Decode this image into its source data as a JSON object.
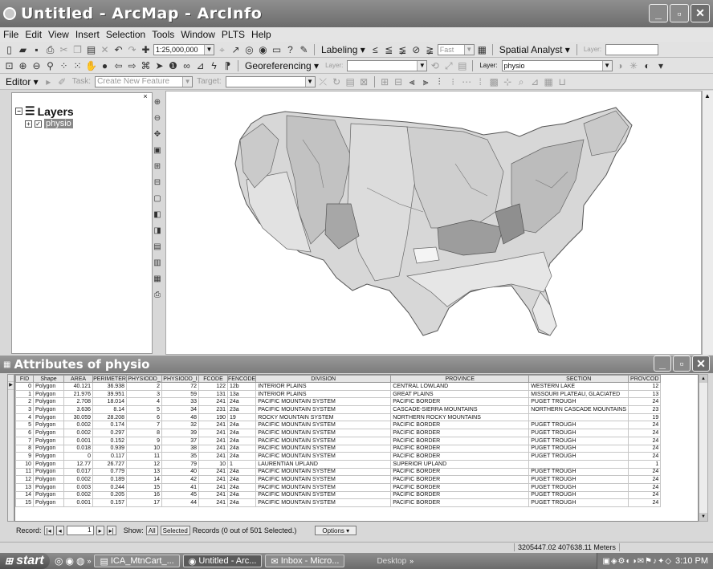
{
  "window": {
    "title": "Untitled - ArcMap - ArcInfo",
    "min": "_",
    "max": "▫",
    "close": "✕"
  },
  "menu": [
    "File",
    "Edit",
    "View",
    "Insert",
    "Selection",
    "Tools",
    "Window",
    "PLTS",
    "Help"
  ],
  "toolbar1": {
    "scale": "1:25,000,000",
    "labeling": "Labeling ▾",
    "fast": "Fast",
    "spatial_analyst": "Spatial Analyst ▾",
    "layer_label": "Layer:"
  },
  "toolbar2": {
    "georef": "Georeferencing ▾",
    "layer_label": "Layer:",
    "layer_label2": "Layer:",
    "layer_value": "physio"
  },
  "toolbar3": {
    "editor": "Editor ▾",
    "task_label": "Task:",
    "task_value": "Create New Feature",
    "target_label": "Target:"
  },
  "toc": {
    "heading": "Layers",
    "layer": "physio"
  },
  "attributes": {
    "title": "Attributes of physio",
    "columns": [
      "FID",
      "Shape",
      "AREA",
      "PERIMETER",
      "PHYSIODD_",
      "PHYSIODD_I",
      "FCODE",
      "FENCODE",
      "DIVISION",
      "PROVINCE",
      "SECTION",
      "PROVCOD"
    ],
    "rows": [
      [
        "0",
        "Polygon",
        "40.121",
        "36.938",
        "2",
        "72",
        "122",
        "12b",
        "INTERIOR PLAINS",
        "CENTRAL LOWLAND",
        "WESTERN LAKE",
        "12"
      ],
      [
        "1",
        "Polygon",
        "21.976",
        "39.951",
        "3",
        "59",
        "131",
        "13a",
        "INTERIOR PLAINS",
        "GREAT PLAINS",
        "MISSOURI PLATEAU, GLACIATED",
        "13"
      ],
      [
        "2",
        "Polygon",
        "2.708",
        "18.014",
        "4",
        "33",
        "241",
        "24a",
        "PACIFIC MOUNTAIN SYSTEM",
        "PACIFIC BORDER",
        "PUGET TROUGH",
        "24"
      ],
      [
        "3",
        "Polygon",
        "3.636",
        "8.14",
        "5",
        "34",
        "231",
        "23a",
        "PACIFIC MOUNTAIN SYSTEM",
        "CASCADE-SIERRA MOUNTAINS",
        "NORTHERN CASCADE MOUNTAINS",
        "23"
      ],
      [
        "4",
        "Polygon",
        "30.059",
        "28.208",
        "6",
        "48",
        "190",
        "19",
        "ROCKY MOUNTAIN SYSTEM",
        "NORTHERN ROCKY MOUNTAINS",
        "",
        "19"
      ],
      [
        "5",
        "Polygon",
        "0.002",
        "0.174",
        "7",
        "32",
        "241",
        "24a",
        "PACIFIC MOUNTAIN SYSTEM",
        "PACIFIC BORDER",
        "PUGET TROUGH",
        "24"
      ],
      [
        "6",
        "Polygon",
        "0.002",
        "0.297",
        "8",
        "39",
        "241",
        "24a",
        "PACIFIC MOUNTAIN SYSTEM",
        "PACIFIC BORDER",
        "PUGET TROUGH",
        "24"
      ],
      [
        "7",
        "Polygon",
        "0.001",
        "0.152",
        "9",
        "37",
        "241",
        "24a",
        "PACIFIC MOUNTAIN SYSTEM",
        "PACIFIC BORDER",
        "PUGET TROUGH",
        "24"
      ],
      [
        "8",
        "Polygon",
        "0.018",
        "0.939",
        "10",
        "38",
        "241",
        "24a",
        "PACIFIC MOUNTAIN SYSTEM",
        "PACIFIC BORDER",
        "PUGET TROUGH",
        "24"
      ],
      [
        "9",
        "Polygon",
        "0",
        "0.117",
        "11",
        "35",
        "241",
        "24a",
        "PACIFIC MOUNTAIN SYSTEM",
        "PACIFIC BORDER",
        "PUGET TROUGH",
        "24"
      ],
      [
        "10",
        "Polygon",
        "12.77",
        "26.727",
        "12",
        "79",
        "10",
        "1",
        "LAURENTIAN UPLAND",
        "SUPERIOR UPLAND",
        "",
        "1"
      ],
      [
        "11",
        "Polygon",
        "0.017",
        "0.779",
        "13",
        "40",
        "241",
        "24a",
        "PACIFIC MOUNTAIN SYSTEM",
        "PACIFIC BORDER",
        "PUGET TROUGH",
        "24"
      ],
      [
        "12",
        "Polygon",
        "0.002",
        "0.189",
        "14",
        "42",
        "241",
        "24a",
        "PACIFIC MOUNTAIN SYSTEM",
        "PACIFIC BORDER",
        "PUGET TROUGH",
        "24"
      ],
      [
        "13",
        "Polygon",
        "0.003",
        "0.244",
        "15",
        "41",
        "241",
        "24a",
        "PACIFIC MOUNTAIN SYSTEM",
        "PACIFIC BORDER",
        "PUGET TROUGH",
        "24"
      ],
      [
        "14",
        "Polygon",
        "0.002",
        "0.205",
        "16",
        "45",
        "241",
        "24a",
        "PACIFIC MOUNTAIN SYSTEM",
        "PACIFIC BORDER",
        "PUGET TROUGH",
        "24"
      ],
      [
        "15",
        "Polygon",
        "0.001",
        "0.157",
        "17",
        "44",
        "241",
        "24a",
        "PACIFIC MOUNTAIN SYSTEM",
        "PACIFIC BORDER",
        "PUGET TROUGH",
        "24"
      ]
    ]
  },
  "nav": {
    "record_label": "Record:",
    "record_value": "1",
    "show_label": "Show:",
    "all": "All",
    "selected": "Selected",
    "records_text": "Records (0 out of 501 Selected.)",
    "options": "Options ▾"
  },
  "status": {
    "coords": "3205447.02  407638.11 Meters"
  },
  "taskbar": {
    "start": "start",
    "tasks": [
      "ICA_MtnCart_...",
      "Untitled - Arc...",
      "Inbox - Micro..."
    ],
    "desktop": "Desktop",
    "clock": "3:10 PM"
  }
}
